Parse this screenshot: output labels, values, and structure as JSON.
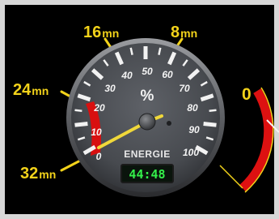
{
  "time_labels": {
    "t16": {
      "value": "16",
      "unit": "mn"
    },
    "t8": {
      "value": "8",
      "unit": "mn"
    },
    "t24": {
      "value": "24",
      "unit": "mn"
    },
    "t0": {
      "value": "0"
    },
    "t32": {
      "value": "32",
      "unit": "mn"
    }
  },
  "gauge": {
    "unit_symbol": "%",
    "caption": "ENERGIE",
    "scale_labels": [
      "0",
      "10",
      "20",
      "30",
      "40",
      "50",
      "60",
      "70",
      "80",
      "90",
      "100"
    ],
    "needle_value": 15,
    "digital_readout": "44:48"
  },
  "colors": {
    "frame": "#d7d7d7",
    "label_yellow": "#f2d21a",
    "dial_face": "#4a4d52",
    "low_zone_red": "#d81010",
    "arc_red": "#dd1111",
    "needle_yellow": "#f0d83a",
    "digital_green": "#34f04a"
  }
}
